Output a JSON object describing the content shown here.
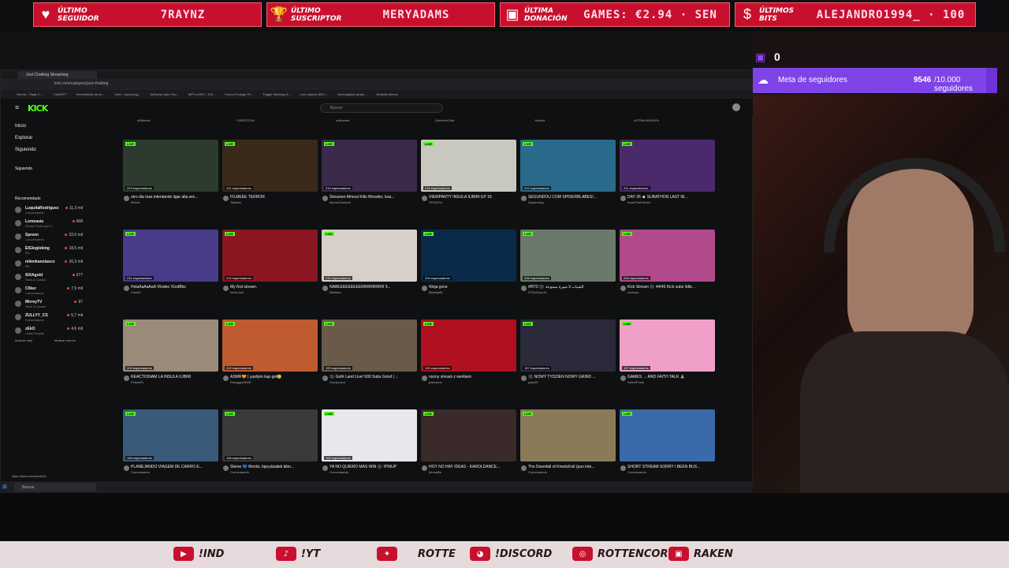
{
  "overlay": {
    "boxes": [
      {
        "label": "ÚLTIMO SEGUIDOR",
        "value": "7RAYNZ",
        "icon": "heart-icon"
      },
      {
        "label": "ÚLTIMO SUSCRIPTOR",
        "value": "MERYADAMS",
        "icon": "trophy-icon"
      },
      {
        "label": "ÚLTIMA DONACIÓN",
        "value": "GAMES: €2.94 · SEN",
        "icon": "cash-register-icon"
      },
      {
        "label": "ÚLTIMOS BITS",
        "value": "ALEJANDRO1994_ · 100",
        "icon": "money-bag-icon"
      }
    ],
    "follower_count": "0",
    "goal": {
      "label": "Meta de seguidores",
      "current": "9546",
      "target": "/10.000 seguidores",
      "progress": 0.9546
    },
    "bottom_links": [
      "!IND",
      "!YT",
      "ROTTE",
      "!DISCORD",
      "ROTTENCOR",
      "RAKEN"
    ]
  },
  "browser": {
    "tab_title": "Just Chatting Streaming",
    "url": "kick.com/category/just-chatting",
    "bookmarks": [
      "Hormiz - Rage 2 -...",
      "ChatGPT",
      "Herramienta de an...",
      "UnM - Upcoming...",
      "AdSense para You...",
      "MP3 a MP4 - 100...",
      "Found Footage Fil...",
      "Trigger Warning D...",
      "Los mejores 600+...",
      "Descargador gratui...",
      "Noticias directs"
    ]
  },
  "kick": {
    "logo": "KICK",
    "search_placeholder": "Buscar",
    "nav": [
      "Inicio",
      "Explorar",
      "Siguiendo"
    ],
    "following_header": "Siguiendo",
    "recommended_header": "Recomendado",
    "recommended": [
      {
        "name": "LuquitaRodriguez",
        "cat": "Conversando",
        "views": "11,3 mil"
      },
      {
        "name": "Lomeasia",
        "cat": "Grand Theft Auto V",
        "views": "568"
      },
      {
        "name": "Spreen",
        "cat": "Conversando",
        "views": "22,6 mil"
      },
      {
        "name": "ElGlogloking",
        "cat": "IRL",
        "views": "18,5 mil"
      },
      {
        "name": "milenkanolasco",
        "cat": "IRL",
        "views": "16,3 mil"
      },
      {
        "name": "SIXAgold",
        "cat": "Slots & Casino",
        "views": "277"
      },
      {
        "name": "C0ker",
        "cat": "Conversando",
        "views": "7,9 mil"
      },
      {
        "name": "MirreyTV",
        "cat": "Slots & Casino",
        "views": "97"
      },
      {
        "name": "ZULLYY_CS",
        "cat": "Conversando",
        "views": "5,7 mil"
      },
      {
        "name": "zEkO",
        "cat": "Clash Royale",
        "views": "4,6 mil"
      }
    ],
    "show_more": "Mostrar más",
    "show_less": "Mostrar menos",
    "top_channels": [
      "nBkibuds",
      "CHEEZY3Xx",
      "xxMoeeta",
      "QuinteroChile",
      "Yolebot",
      "xSTR8xSAVAGEx"
    ],
    "cards": [
      {
        "title": "otro dia mas intentando ligar alla sec...",
        "ch": "Mhisei",
        "views": "223 espectadores",
        "color": "#2d3b2f"
      },
      {
        "title": "FILMEEE TERROR",
        "ch": "Talkasiz",
        "views": "221 espectadores",
        "color": "#3a2a1c"
      },
      {
        "title": "Streamer Almost Kills Wrestler, Isra...",
        "ch": "MyrrorGamesX",
        "views": "219 espectadores",
        "color": "#3b2a4a"
      },
      {
        "title": "VIEWPARTY INSULA ILIBIRI EP 16",
        "ch": "STK0LEo",
        "views": "215 espectadores",
        "color": "#c9c9c0"
      },
      {
        "title": "SEGUNDOU COM SPIDERBLABES!...",
        "ch": "SpiderKing",
        "views": "212 espectadores",
        "color": "#2a6a8a"
      },
      {
        "title": "DAY 26 ☻ SUBATHON LAST W...",
        "ch": "AcabTheKitchen",
        "views": "211 espectadores",
        "color": "#4a2a6a"
      },
      {
        "title": "HolaAaAaAaA !Rodeo !GodBks",
        "ch": "CrissiV",
        "views": "211 espectadores",
        "color": "#4a3a8a"
      },
      {
        "title": "My first stream.",
        "ch": "NortoJuel",
        "views": "210 espectadores",
        "color": "#8a1622"
      },
      {
        "title": "NABEEEEEEEEERRRRRRRR !t...",
        "ch": "ReBeria",
        "views": "210 espectadores",
        "color": "#d8d0c8"
      },
      {
        "title": "Ninja goce",
        "ch": "BlashqtBL",
        "views": "209 espectadores",
        "color": "#0a2a4a"
      },
      {
        "title": "#RTD ⚫ سيرة ممنوعة ‎الشباب لا",
        "ch": "RTDxDuckTo",
        "views": "206 espectadores",
        "color": "#6a7a6a"
      },
      {
        "title": "Kick Stream ⚫ 44/45 Kick subs !idle...",
        "ch": "sortmya",
        "views": "204 espectadores",
        "color": "#b04a8a"
      },
      {
        "title": "REACTIONAM LA INSULA ILIBIRI",
        "ch": "Pulsell21",
        "views": "203 espectadores",
        "color": "#9a8a7a"
      },
      {
        "title": "ASMR🧡 | yashjim kap gel😊",
        "ch": "SaraggsASMR",
        "views": "202 espectadores",
        "color": "#c05a30"
      },
      {
        "title": "⚫ Goth Land Live! 500 Subs Grind | ...",
        "ch": "GumpLand",
        "views": "199 espectadores",
        "color": "#6a5a4a"
      },
      {
        "title": "nocny stream z werkiem",
        "ch": "joshwans",
        "views": "199 espectadores",
        "color": "#b01020"
      },
      {
        "title": "⚫ NOWY TYDZIEŃ NOWY GRIND ...",
        "ch": "pyka97",
        "views": "197 espectadores",
        "color": "#2a2a3a"
      },
      {
        "title": "GAMES → AND FAITH TALK 🙏",
        "ch": "SamXFrank",
        "views": "197 espectadores",
        "color": "#f0a0c8"
      },
      {
        "title": "PLANEJANDO VIAGEM DE CARRO E...",
        "ch": "Conversando",
        "views": "196 espectadores",
        "color": "#3a5a7a"
      },
      {
        "title": "Sleme 💙 Mordo, fajnydziałek blim...",
        "ch": "Conversando",
        "views": "196 espectadores",
        "color": "#3a3a3a"
      },
      {
        "title": "YA NO QUIERO MAS WIN ⚫ !PINUP",
        "ch": "Conversando",
        "views": "192 espectadores",
        "color": "#e8e8ec"
      },
      {
        "title": "HOY NO HAY IDEAS - KAROLDANCE...",
        "ch": "MrecaBe",
        "views": "",
        "color": "#3a2a2a"
      },
      {
        "title": "The Downfall of KineticKell (pun inte...",
        "ch": "Conversando",
        "views": "",
        "color": "#8a7a5a"
      },
      {
        "title": "SHORT STREAM SORRY I BEEN BUS...",
        "ch": "Conversando",
        "views": "",
        "color": "#3a6aaa"
      }
    ],
    "live_label": "LIVE",
    "conversando": "Conversando",
    "status_url": "https://kick.com/nicole3x"
  },
  "taskbar": {
    "search": "Buscar"
  }
}
